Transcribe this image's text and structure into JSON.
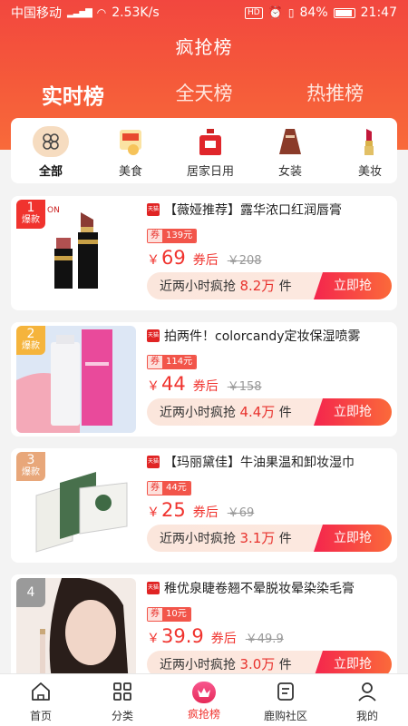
{
  "status": {
    "carrier": "中国移动",
    "net_speed": "2.53K/s",
    "battery": "84%",
    "time": "21:47"
  },
  "page_title": "疯抢榜",
  "tabs": [
    {
      "label": "实时榜",
      "active": true
    },
    {
      "label": "全天榜",
      "active": false
    },
    {
      "label": "热推榜",
      "active": false
    }
  ],
  "categories": [
    {
      "label": "全部",
      "icon": "grid-flower-icon",
      "active": true
    },
    {
      "label": "美食",
      "icon": "food-icon"
    },
    {
      "label": "居家日用",
      "icon": "detergent-bottle-icon"
    },
    {
      "label": "女装",
      "icon": "dress-icon"
    },
    {
      "label": "美妆",
      "icon": "lipstick-icon"
    }
  ],
  "products": [
    {
      "rank": "1",
      "rank_tag": "爆款",
      "rank_color": "#f0332e",
      "title": "【薇娅推荐】露华浓口红润唇膏",
      "coupon_label": "券",
      "coupon_value": "139元",
      "currency": "￥",
      "price": "69",
      "after_label": "券后",
      "original_price": "￥208",
      "sales_text": "近两小时疯抢",
      "sales_num": "8.2万",
      "sales_unit": "件",
      "buy_label": "立即抢"
    },
    {
      "rank": "2",
      "rank_tag": "爆款",
      "rank_color": "#f5b43c",
      "title": "拍两件！colorcandy定妆保湿喷雾",
      "coupon_label": "券",
      "coupon_value": "114元",
      "currency": "￥",
      "price": "44",
      "after_label": "券后",
      "original_price": "￥158",
      "sales_text": "近两小时疯抢",
      "sales_num": "4.4万",
      "sales_unit": "件",
      "buy_label": "立即抢"
    },
    {
      "rank": "3",
      "rank_tag": "爆款",
      "rank_color": "#e8a77a",
      "title": "【玛丽黛佳】牛油果温和卸妆湿巾",
      "coupon_label": "券",
      "coupon_value": "44元",
      "currency": "￥",
      "price": "25",
      "after_label": "券后",
      "original_price": "￥69",
      "sales_text": "近两小时疯抢",
      "sales_num": "3.1万",
      "sales_unit": "件",
      "buy_label": "立即抢"
    },
    {
      "rank": "4",
      "rank_tag": "",
      "rank_color": "#9a9a9a",
      "title": "稚优泉睫卷翘不晕脱妆晕染染毛膏",
      "coupon_label": "券",
      "coupon_value": "10元",
      "currency": "￥",
      "price": "39.9",
      "after_label": "券后",
      "original_price": "￥49.9",
      "sales_text": "近两小时疯抢",
      "sales_num": "3.0万",
      "sales_unit": "件",
      "buy_label": "立即抢"
    }
  ],
  "bottom_nav": [
    {
      "label": "首页",
      "icon": "home-icon"
    },
    {
      "label": "分类",
      "icon": "category-grid-icon"
    },
    {
      "label": "疯抢榜",
      "icon": "crown-icon",
      "active": true
    },
    {
      "label": "鹿购社区",
      "icon": "community-doc-icon"
    },
    {
      "label": "我的",
      "icon": "profile-icon"
    }
  ]
}
